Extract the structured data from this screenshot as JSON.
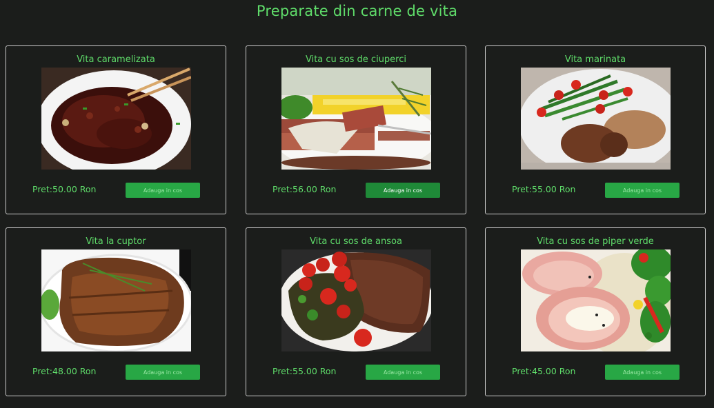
{
  "page": {
    "title": "Preparate din carne de vita"
  },
  "products": [
    {
      "title": "Vita caramelizata",
      "price": "Pret:50.00 Ron",
      "button": "Adauga in cos",
      "image": "caramelized-beef-image"
    },
    {
      "title": "Vita cu sos de ciuperci",
      "price": "Pret:56.00 Ron",
      "button": "Adauga in cos",
      "image": "beef-mushroom-sauce-image",
      "button_state": "hovered"
    },
    {
      "title": "Vita marinata",
      "price": "Pret:55.00 Ron",
      "button": "Adauga in cos",
      "image": "marinated-beef-image"
    },
    {
      "title": "Vita la cuptor",
      "price": "Pret:48.00 Ron",
      "button": "Adauga in cos",
      "image": "roast-beef-image"
    },
    {
      "title": "Vita cu sos de ansoa",
      "price": "Pret:55.00 Ron",
      "button": "Adauga in cos",
      "image": "beef-anchovy-sauce-image"
    },
    {
      "title": "Vita cu sos de piper verde",
      "price": "Pret:45.00 Ron",
      "button": "Adauga in cos",
      "image": "beef-green-pepper-sauce-image"
    }
  ],
  "colors": {
    "background": "#1b1d1b",
    "accent": "#5fdc6a",
    "button": "#28a745",
    "button_hover": "#1f8a38"
  }
}
